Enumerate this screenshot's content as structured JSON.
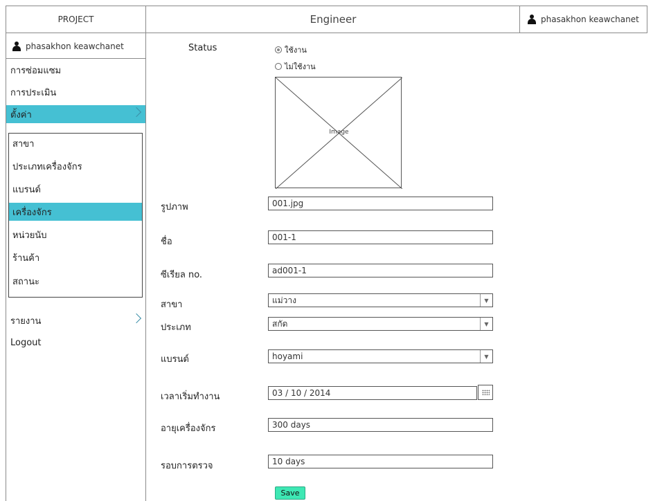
{
  "header": {
    "brand": "PROJECT",
    "title": "Engineer",
    "user": "phasakhon keawchanet"
  },
  "sidebar": {
    "user": "phasakhon keawchanet",
    "items": [
      {
        "label": "การซ่อมแซม"
      },
      {
        "label": "การประเมิน"
      },
      {
        "label": "ตั้งค่า",
        "active": true,
        "expanded": true
      },
      {
        "label": "รายงาน"
      },
      {
        "label": "Logout"
      }
    ],
    "submenu": [
      {
        "label": "สาขา"
      },
      {
        "label": "ประเภทเครื่องจักร"
      },
      {
        "label": "แบรนด์"
      },
      {
        "label": "เครื่องจักร",
        "active": true
      },
      {
        "label": "หน่วยนับ"
      },
      {
        "label": "ร้านค้า"
      },
      {
        "label": "สถานะ"
      }
    ]
  },
  "form": {
    "status_label": "Status",
    "status_options": [
      {
        "label": "ใช้งาน",
        "checked": true
      },
      {
        "label": "ไม่ใช้งาน",
        "checked": false
      }
    ],
    "image_placeholder": "Image",
    "fields": {
      "image": {
        "label": "รูปภาพ",
        "value": "001.jpg"
      },
      "name": {
        "label": "ชื่อ",
        "value": "001-1"
      },
      "serial": {
        "label": "ซีเรียล no.",
        "value": "ad001-1"
      },
      "branch": {
        "label": "สาขา",
        "value": "แม่วาง"
      },
      "type": {
        "label": "ประเภท",
        "value": "สกัด"
      },
      "brand": {
        "label": "แบรนด์",
        "value": "hoyami"
      },
      "start_date": {
        "label": "เวลาเริ่มทำงาน",
        "value": "03 / 10 / 2014"
      },
      "machine_age": {
        "label": "อายุเครื่องจักร",
        "value": "300 days"
      },
      "inspection_cycle": {
        "label": "รอบการตรวจ",
        "value": "10 days"
      }
    },
    "save_label": "Save"
  },
  "colors": {
    "accent": "#45c0d3",
    "save": "#3ee8b4",
    "border": "#8a8a8a"
  }
}
